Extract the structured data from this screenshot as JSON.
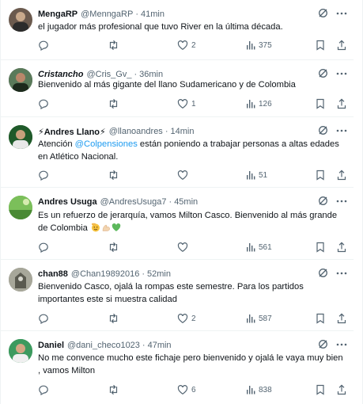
{
  "tweets": [
    {
      "name": "MengaRP",
      "handle": "@MenngaRP",
      "time": "41min",
      "text": "el jugador más profesional que tuvo River en la última década.",
      "replies": "",
      "retweets": "",
      "likes": "2",
      "views": "375",
      "avatar_color": "#6b5a4e"
    },
    {
      "name": "Cristancho",
      "handle": "@Cris_Gv_",
      "time": "36min",
      "text": "Bienvenido al más gigante del llano Sudamericano y de Colombia",
      "replies": "",
      "retweets": "",
      "likes": "1",
      "views": "126",
      "avatar_color": "#3a4a3e"
    },
    {
      "name_prefix": "⚡",
      "name": "Andres Llano",
      "name_suffix": "⚡",
      "handle": "@llanoandres",
      "time": "14min",
      "text_before": "Atención ",
      "mention": "@Colpensiones",
      "text_after": " están poniendo a trabajar personas a altas edades en Atlético Nacional.",
      "replies": "",
      "retweets": "",
      "likes": "",
      "views": "51",
      "avatar_color": "#2f6b2f"
    },
    {
      "name": "Andres Usuga",
      "handle": "@AndresUsuga7",
      "time": "45min",
      "text": "Es un refuerzo de jerarquía, vamos Milton Casco. Bienvenido al más grande de Colombia",
      "replies": "",
      "retweets": "",
      "likes": "",
      "views": "561",
      "avatar_color": "#5fa84a"
    },
    {
      "name": "chan88",
      "handle": "@Chan19892016",
      "time": "52min",
      "text": "Bienvenido Casco, ojalá la rompas este semestre. Para los partidos importantes este si muestra calidad",
      "replies": "",
      "retweets": "",
      "likes": "2",
      "views": "587",
      "avatar_color": "#8a8a7a"
    },
    {
      "name": "Daniel",
      "handle": "@dani_checo1023",
      "time": "47min",
      "text": "No me convence mucho este fichaje pero bienvenido y ojalá le vaya muy bien , vamos Milton",
      "replies": "",
      "retweets": "",
      "likes": "6",
      "views": "838",
      "avatar_color": "#2e8b57"
    }
  ],
  "dot": "·",
  "colors": {
    "text": "#0f1419",
    "muted": "#536471",
    "link": "#1d9bf0",
    "border": "#eff3f4"
  }
}
